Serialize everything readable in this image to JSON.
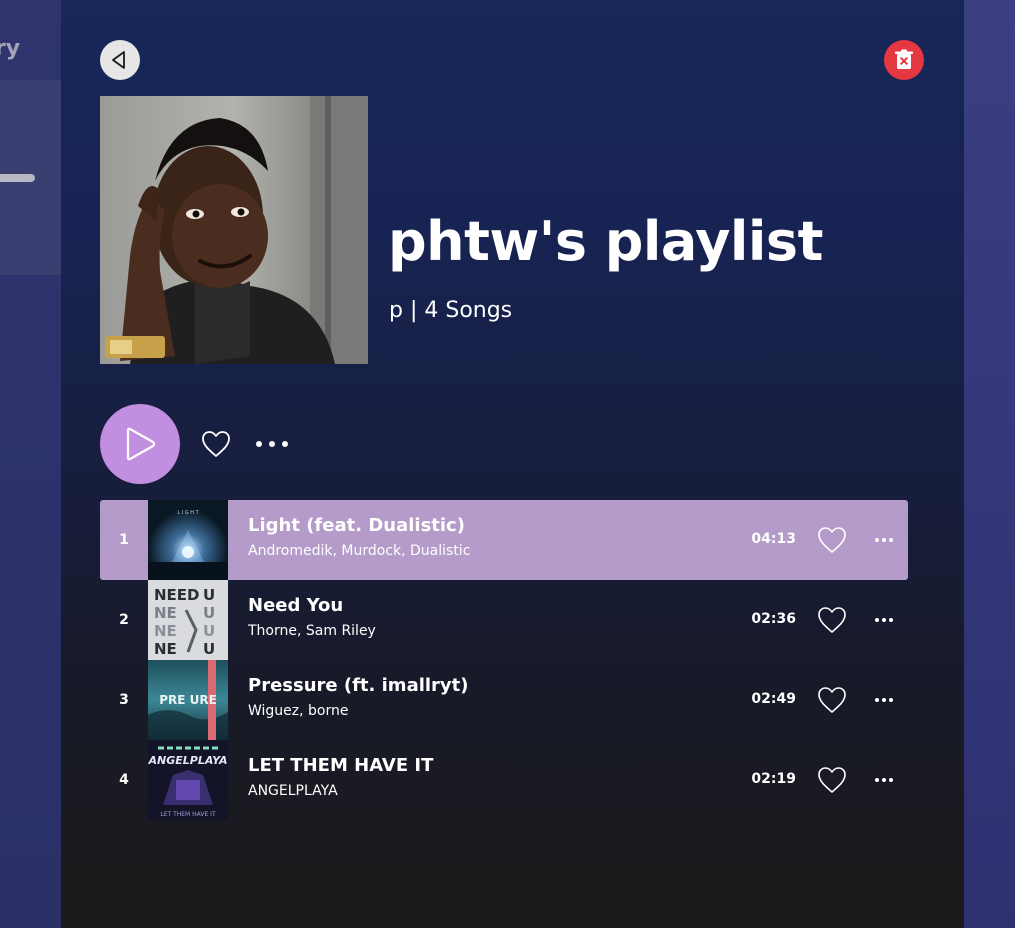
{
  "sidebar": {
    "title_fragment": "ary"
  },
  "header": {
    "back_icon": "back-arrow-icon",
    "delete_icon": "trash-icon"
  },
  "playlist": {
    "title": "phtw's playlist",
    "meta": "p | 4 Songs"
  },
  "controls": {
    "play_icon": "play-icon",
    "like_icon": "heart-icon",
    "more_icon": "more-dots-icon"
  },
  "tracks": [
    {
      "number": "1",
      "title": "Light (feat. Dualistic)",
      "artists": "Andromedik, Murdock, Dualistic",
      "duration": "04:13",
      "active": true
    },
    {
      "number": "2",
      "title": "Need You",
      "artists": "Thorne, Sam Riley",
      "duration": "02:36",
      "active": false
    },
    {
      "number": "3",
      "title": "Pressure (ft. imallryt)",
      "artists": "Wiguez, borne",
      "duration": "02:49",
      "active": false
    },
    {
      "number": "4",
      "title": "LET THEM HAVE IT",
      "artists": "ANGELPLAYA",
      "duration": "02:19",
      "active": false
    }
  ],
  "colors": {
    "accent_play": "#c18ee0",
    "active_row": "#b49bc9",
    "delete": "#e5373f"
  }
}
